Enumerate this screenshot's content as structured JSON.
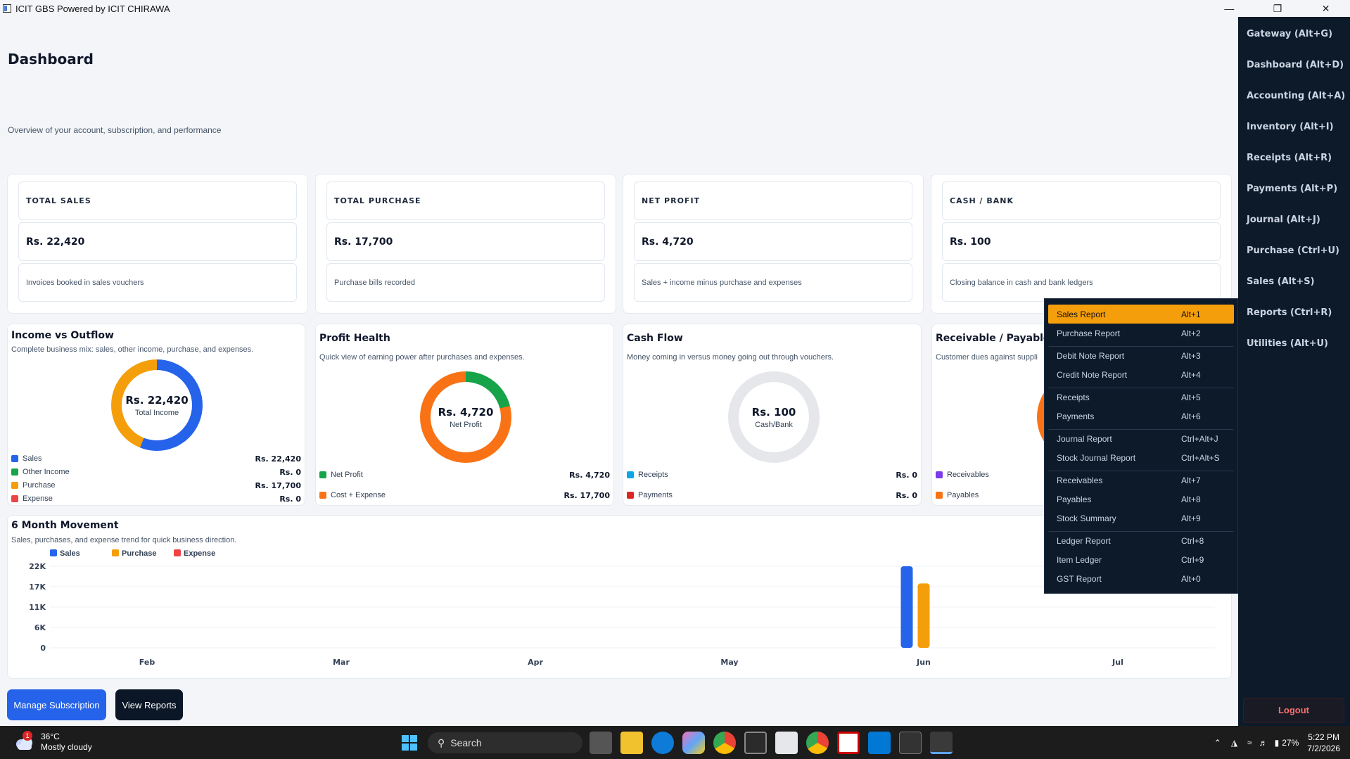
{
  "window": {
    "title": "ICIT GBS Powered by ICIT CHIRAWA",
    "minimize": "—",
    "restore": "❐",
    "close": "✕"
  },
  "page": {
    "title": "Dashboard",
    "subtitle": "Overview of your account, subscription, and performance"
  },
  "stats": [
    {
      "label": "TOTAL SALES",
      "value": "Rs. 22,420",
      "note": "Invoices booked in sales vouchers"
    },
    {
      "label": "TOTAL PURCHASE",
      "value": "Rs. 17,700",
      "note": "Purchase bills recorded"
    },
    {
      "label": "NET PROFIT",
      "value": "Rs. 4,720",
      "note": "Sales + income minus purchase and expenses"
    },
    {
      "label": "CASH / BANK",
      "value": "Rs. 100",
      "note": "Closing balance in cash and bank ledgers"
    }
  ],
  "panels": {
    "income": {
      "title": "Income vs Outflow",
      "desc": "Complete business mix: sales, other income, purchase, and expenses.",
      "center_value": "Rs. 22,420",
      "center_label": "Total Income",
      "legend": [
        {
          "name": "Sales",
          "amount": "Rs. 22,420",
          "color": "#2563eb"
        },
        {
          "name": "Other Income",
          "amount": "Rs. 0",
          "color": "#16a34a"
        },
        {
          "name": "Purchase",
          "amount": "Rs. 17,700",
          "color": "#f59e0b"
        },
        {
          "name": "Expense",
          "amount": "Rs. 0",
          "color": "#ef4444"
        }
      ]
    },
    "profit": {
      "title": "Profit Health",
      "desc": "Quick view of earning power after purchases and expenses.",
      "center_value": "Rs. 4,720",
      "center_label": "Net Profit",
      "legend": [
        {
          "name": "Net Profit",
          "amount": "Rs. 4,720",
          "color": "#16a34a"
        },
        {
          "name": "Cost + Expense",
          "amount": "Rs. 17,700",
          "color": "#f97316"
        }
      ]
    },
    "cashflow": {
      "title": "Cash Flow",
      "desc": "Money coming in versus money going out through vouchers.",
      "center_value": "Rs. 100",
      "center_label": "Cash/Bank",
      "legend": [
        {
          "name": "Receipts",
          "amount": "Rs. 0",
          "color": "#0ea5e9"
        },
        {
          "name": "Payments",
          "amount": "Rs. 0",
          "color": "#dc2626"
        }
      ]
    },
    "receivable": {
      "title": "Receivable / Payable",
      "desc": "Customer dues against suppli",
      "legend": [
        {
          "name": "Receivables",
          "color": "#7c3aed"
        },
        {
          "name": "Payables",
          "color": "#f97316"
        }
      ]
    }
  },
  "movement": {
    "title": "6 Month Movement",
    "desc": "Sales, purchases, and expense trend for quick business direction."
  },
  "chart_data": {
    "type": "bar",
    "categories": [
      "Feb",
      "Mar",
      "Apr",
      "May",
      "Jun",
      "Jul"
    ],
    "series": [
      {
        "name": "Sales",
        "color": "#2563eb",
        "values": [
          0,
          0,
          0,
          0,
          22420,
          0
        ]
      },
      {
        "name": "Purchase",
        "color": "#f59e0b",
        "values": [
          0,
          0,
          0,
          0,
          17700,
          0
        ]
      },
      {
        "name": "Expense",
        "color": "#ef4444",
        "values": [
          0,
          0,
          0,
          0,
          0,
          0
        ]
      }
    ],
    "yticks": [
      "0",
      "6K",
      "11K",
      "17K",
      "22K"
    ],
    "ylim": [
      0,
      22420
    ],
    "grid": true,
    "legend_position": "top-left"
  },
  "buttons": {
    "manage": "Manage Subscription",
    "reports": "View Reports"
  },
  "sidebar": {
    "items": [
      "Gateway (Alt+G)",
      "Dashboard (Alt+D)",
      "Accounting (Alt+A)",
      "Inventory (Alt+I)",
      "Receipts (Alt+R)",
      "Payments (Alt+P)",
      "Journal (Alt+J)",
      "Purchase (Ctrl+U)",
      "Sales (Alt+S)",
      "Reports (Ctrl+R)",
      "Utilities (Alt+U)"
    ],
    "logout": "Logout"
  },
  "reports_menu": [
    {
      "label": "Sales Report",
      "key": "Alt+1",
      "selected": true
    },
    {
      "label": "Purchase Report",
      "key": "Alt+2"
    },
    {
      "label": "Debit Note Report",
      "key": "Alt+3",
      "group_start": true
    },
    {
      "label": "Credit Note Report",
      "key": "Alt+4"
    },
    {
      "label": "Receipts",
      "key": "Alt+5",
      "group_start": true
    },
    {
      "label": "Payments",
      "key": "Alt+6"
    },
    {
      "label": "Journal Report",
      "key": "Ctrl+Alt+J",
      "group_start": true
    },
    {
      "label": "Stock Journal Report",
      "key": "Ctrl+Alt+S"
    },
    {
      "label": "Receivables",
      "key": "Alt+7",
      "group_start": true
    },
    {
      "label": "Payables",
      "key": "Alt+8"
    },
    {
      "label": "Stock Summary",
      "key": "Alt+9"
    },
    {
      "label": "Ledger Report",
      "key": "Ctrl+8",
      "group_start": true
    },
    {
      "label": "Item Ledger",
      "key": "Ctrl+9"
    },
    {
      "label": "GST Report",
      "key": "Alt+0"
    }
  ],
  "taskbar": {
    "temp": "36°C",
    "condition": "Mostly cloudy",
    "badge": "1",
    "search": "Search",
    "battery": "27%",
    "time": "5:22 PM",
    "date": "7/2/2026"
  }
}
